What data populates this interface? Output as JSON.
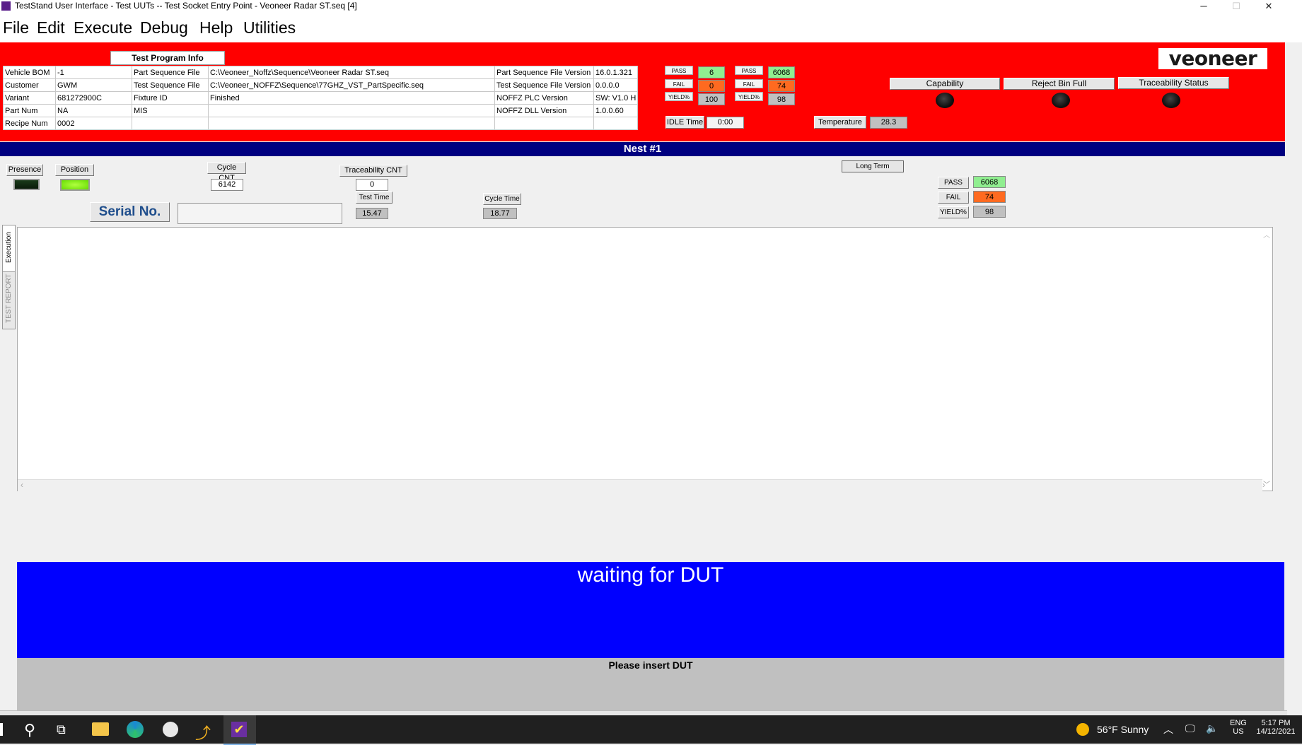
{
  "window": {
    "title": "TestStand User Interface - Test UUTs -- Test Socket Entry Point - Veoneer Radar ST.seq [4]",
    "minimize": "─",
    "maximize": "☐",
    "close": "✕"
  },
  "menu": [
    "File",
    "Edit",
    "Execute",
    "Debug",
    "Help",
    "Utilities"
  ],
  "header": {
    "test_program_info_label": "Test Program Info",
    "info_rows": [
      [
        "Vehicle BOM",
        "-1",
        "Part Sequence File",
        "C:\\Veoneer_Noffz\\Sequence\\Veoneer Radar ST.seq",
        "Part Sequence File Version",
        "16.0.1.321"
      ],
      [
        "Customer",
        "GWM",
        "Test Sequence File",
        "C:\\Veoneer_NOFFZ\\Sequence\\77GHZ_VST_PartSpecific.seq",
        "Test Sequence File Version",
        "0.0.0.0"
      ],
      [
        "Variant",
        "681272900C",
        "Fixture ID",
        "Finished",
        "NOFFZ PLC Version",
        "SW: V1.0 H"
      ],
      [
        "Part Num",
        "NA",
        "MIS",
        "",
        "NOFFZ DLL Version",
        "1.0.0.60"
      ],
      [
        "Recipe Num",
        "0002",
        "",
        "",
        "",
        ""
      ]
    ],
    "counters_left": {
      "pass_label": "PASS",
      "fail_label": "FAIL",
      "yield_label": "YIELD%",
      "pass": "6",
      "fail": "0",
      "yield": "100"
    },
    "counters_right": {
      "pass_label": "PASS",
      "fail_label": "FAIL",
      "yield_label": "YIELD%",
      "pass": "6068",
      "fail": "74",
      "yield": "98"
    },
    "idle_time_label": "IDLE Time",
    "idle_time": "0:00",
    "temperature_label": "Temperature",
    "temperature": "28.3",
    "capability_label": "Capability",
    "reject_bin_label": "Reject Bin Full",
    "traceability_status_label": "Traceability Status",
    "logo": "veoneer"
  },
  "nest": {
    "title": "Nest #1",
    "presence_label": "Presence",
    "position_label": "Position",
    "cycle_cnt_label": "Cycle CNT",
    "cycle_cnt": "6142",
    "traceability_cnt_label": "Traceability CNT",
    "traceability_cnt": "0",
    "test_time_label": "Test Time",
    "test_time": "15.47",
    "cycle_time_label": "Cycle Time",
    "cycle_time": "18.77",
    "serial_label": "Serial No.",
    "serial_value": "",
    "long_term_label": "Long Term",
    "lt_pass_label": "PASS",
    "lt_pass": "6068",
    "lt_fail_label": "FAIL",
    "lt_fail": "74",
    "lt_yield_label": "YIELD%",
    "lt_yield": "98"
  },
  "tabs": {
    "execution": "Execution",
    "test_report": "TEST REPORT"
  },
  "status": {
    "main": "waiting for DUT",
    "message": "Please insert DUT"
  },
  "taskbar": {
    "weather": "56°F  Sunny",
    "lang": "ENG",
    "region": "US",
    "time": "5:17 PM",
    "date": "14/12/2021"
  },
  "colors": {
    "header_bg": "#ff0000",
    "nest_bar": "#000080",
    "wait_bg": "#0000ff",
    "pass": "#90ee90",
    "fail": "#ff6a20"
  }
}
